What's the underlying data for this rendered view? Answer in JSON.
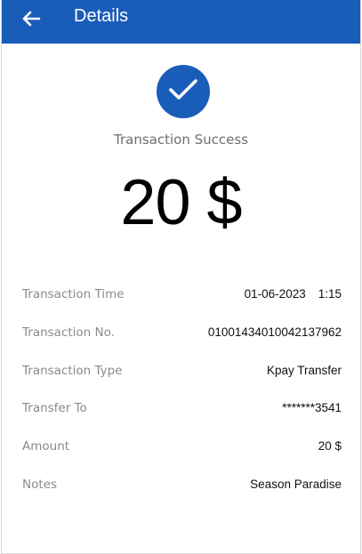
{
  "header": {
    "title": "Details",
    "back_icon": "arrow-left-icon",
    "background": "#1a5db9"
  },
  "status": {
    "icon": "checkmark-icon",
    "text": "Transaction Success",
    "amount": "20 $"
  },
  "details": [
    {
      "label": "Transaction Time",
      "value_date": "01-06-2023",
      "value_time": "1:15"
    },
    {
      "label": "Transaction No.",
      "value": "01001434010042137962"
    },
    {
      "label": "Transaction Type",
      "value": "Kpay Transfer"
    },
    {
      "label": "Transfer To",
      "value": "*******3541"
    },
    {
      "label": "Amount",
      "value": "20 $"
    },
    {
      "label": "Notes",
      "value": "Season Paradise"
    }
  ]
}
